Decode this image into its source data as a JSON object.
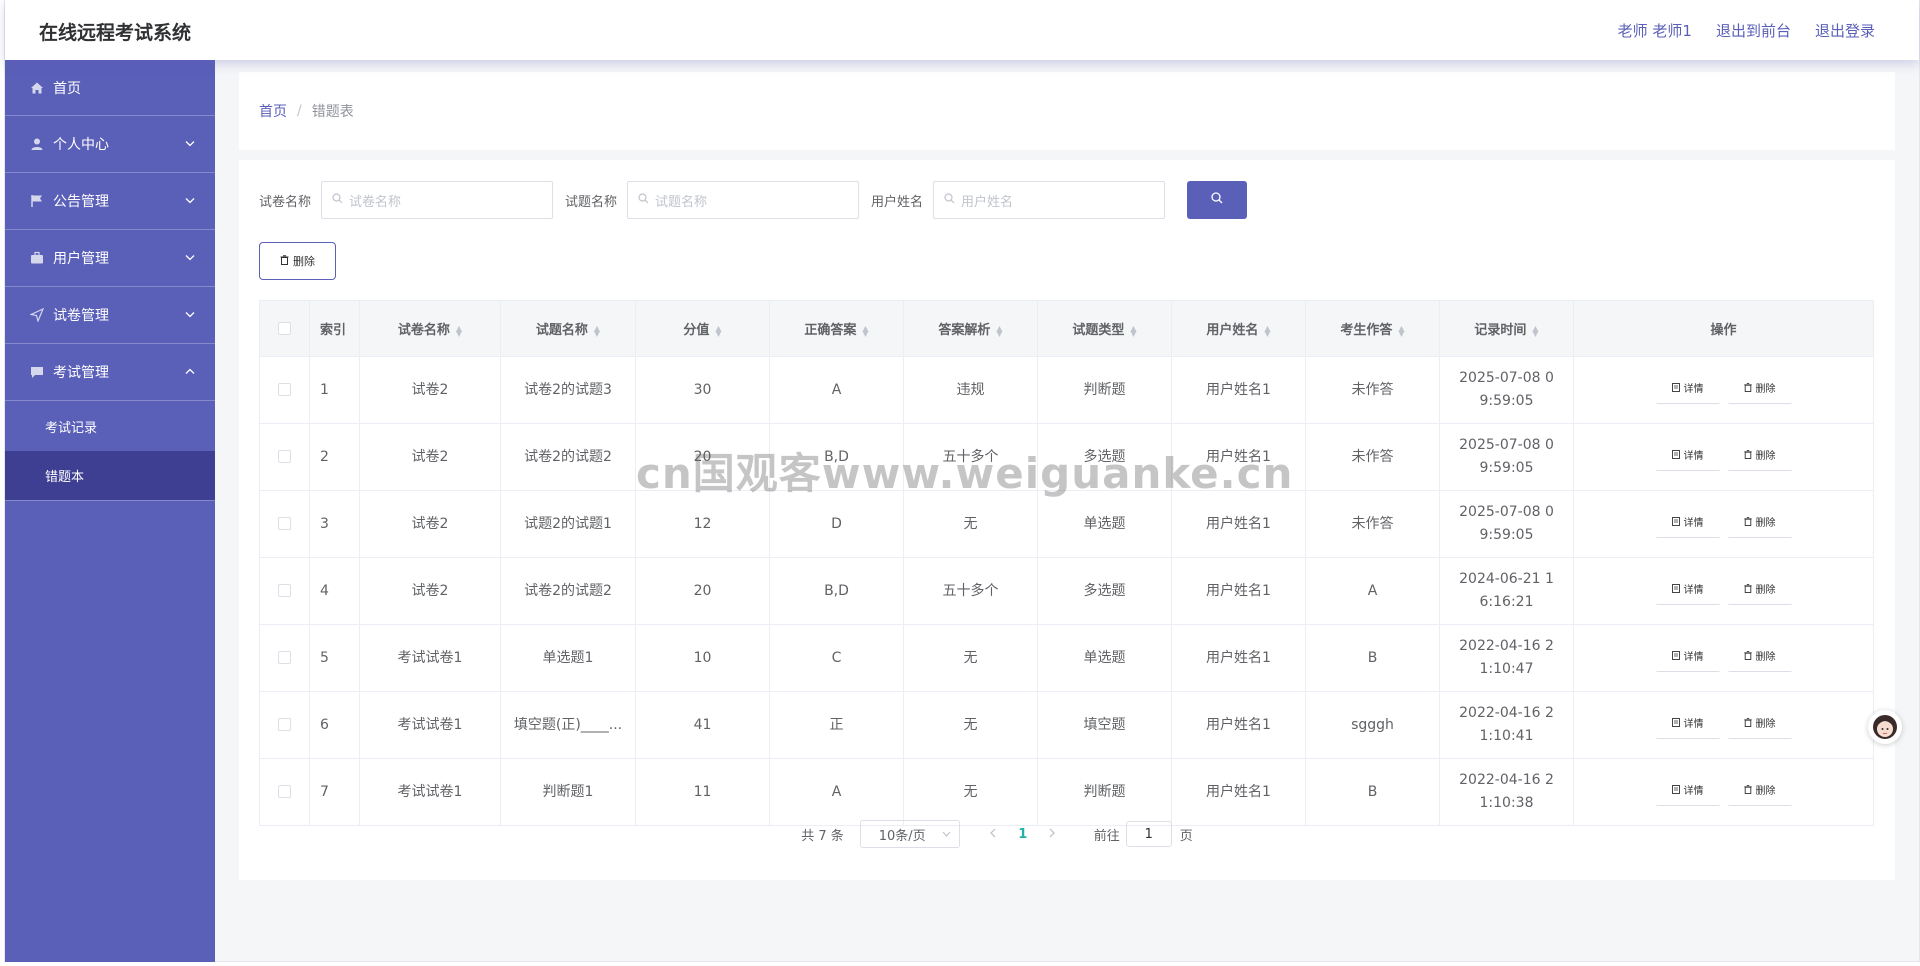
{
  "header": {
    "app_title": "在线远程考试系统",
    "user_label": "老师 老师1",
    "back_frontend": "退出到前台",
    "logout": "退出登录"
  },
  "sidebar": {
    "items": [
      {
        "label": "首页",
        "icon": "home-icon"
      },
      {
        "label": "个人中心",
        "icon": "user-icon"
      },
      {
        "label": "公告管理",
        "icon": "flag-icon"
      },
      {
        "label": "用户管理",
        "icon": "briefcase-icon"
      },
      {
        "label": "试卷管理",
        "icon": "send-icon"
      },
      {
        "label": "考试管理",
        "icon": "message-icon"
      }
    ],
    "sub_items": [
      {
        "label": "考试记录"
      },
      {
        "label": "错题本"
      }
    ]
  },
  "breadcrumb": {
    "home": "首页",
    "current": "错题表"
  },
  "search": {
    "paper_label": "试卷名称",
    "paper_placeholder": "试卷名称",
    "question_label": "试题名称",
    "question_placeholder": "试题名称",
    "user_label": "用户姓名",
    "user_placeholder": "用户姓名"
  },
  "toolbar": {
    "delete_label": "删除"
  },
  "table": {
    "columns": [
      "索引",
      "试卷名称",
      "试题名称",
      "分值",
      "正确答案",
      "答案解析",
      "试题类型",
      "用户姓名",
      "考生作答",
      "记录时间",
      "操作"
    ],
    "rows": [
      {
        "index": "1",
        "paper": "试卷2",
        "question": "试卷2的试题3",
        "score": "30",
        "answer": "A",
        "analysis": "违规",
        "type": "判断题",
        "user": "用户姓名1",
        "response": "未作答",
        "time": "2025-07-08 09:59:05"
      },
      {
        "index": "2",
        "paper": "试卷2",
        "question": "试卷2的试题2",
        "score": "20",
        "answer": "B,D",
        "analysis": "五十多个",
        "type": "多选题",
        "user": "用户姓名1",
        "response": "未作答",
        "time": "2025-07-08 09:59:05"
      },
      {
        "index": "3",
        "paper": "试卷2",
        "question": "试题2的试题1",
        "score": "12",
        "answer": "D",
        "analysis": "无",
        "type": "单选题",
        "user": "用户姓名1",
        "response": "未作答",
        "time": "2025-07-08 09:59:05"
      },
      {
        "index": "4",
        "paper": "试卷2",
        "question": "试卷2的试题2",
        "score": "20",
        "answer": "B,D",
        "analysis": "五十多个",
        "type": "多选题",
        "user": "用户姓名1",
        "response": "A",
        "time": "2024-06-21 16:16:21"
      },
      {
        "index": "5",
        "paper": "考试试卷1",
        "question": "单选题1",
        "score": "10",
        "answer": "C",
        "analysis": "无",
        "type": "单选题",
        "user": "用户姓名1",
        "response": "B",
        "time": "2022-04-16 21:10:47"
      },
      {
        "index": "6",
        "paper": "考试试卷1",
        "question": "填空题(正)____...",
        "score": "41",
        "answer": "正",
        "analysis": "无",
        "type": "填空题",
        "user": "用户姓名1",
        "response": "sgggh",
        "time": "2022-04-16 21:10:41"
      },
      {
        "index": "7",
        "paper": "考试试卷1",
        "question": "判断题1",
        "score": "11",
        "answer": "A",
        "analysis": "无",
        "type": "判断题",
        "user": "用户姓名1",
        "response": "B",
        "time": "2022-04-16 21:10:38"
      }
    ],
    "detail_label": "详情",
    "delete_label": "删除"
  },
  "pagination": {
    "total_text": "共 7 条",
    "page_size": "10条/页",
    "current_page": "1",
    "goto_prefix": "前往",
    "goto_value": "1",
    "goto_suffix": "页"
  },
  "watermark": "cn国观客www.weiguanke.cn",
  "colors": {
    "primary": "#5a5fb8",
    "sidebar_active": "#3e3f93",
    "page_active": "#20b2aa"
  }
}
